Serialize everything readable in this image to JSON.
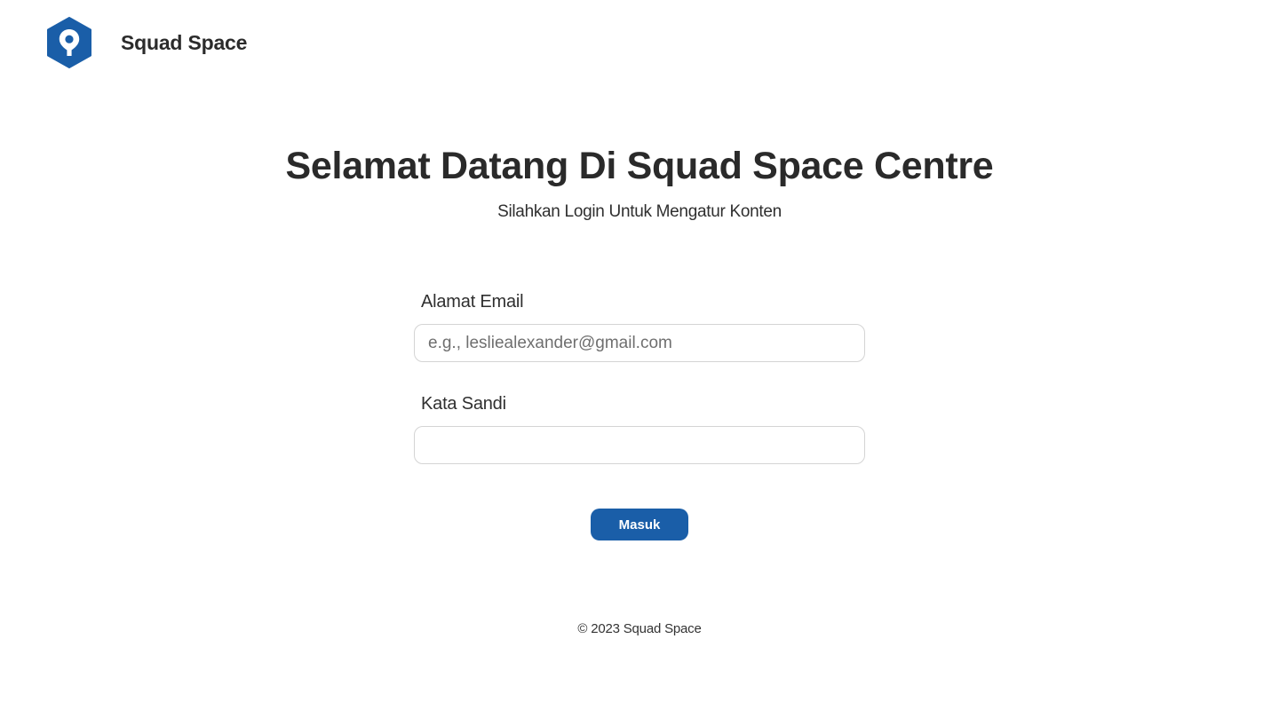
{
  "header": {
    "brand": "Squad Space",
    "logo_icon": "location-pin-hexagon-icon",
    "logo_color": "#1a5ea8"
  },
  "main": {
    "title": "Selamat Datang Di Squad Space Centre",
    "subtitle": "Silahkan Login Untuk Mengatur Konten"
  },
  "form": {
    "email_label": "Alamat Email",
    "email_placeholder": "e.g., lesliealexander@gmail.com",
    "email_value": "",
    "password_label": "Kata Sandi",
    "password_value": "",
    "submit_label": "Masuk",
    "submit_color": "#1a5ea8"
  },
  "footer": {
    "copyright": "© 2023 Squad Space"
  }
}
